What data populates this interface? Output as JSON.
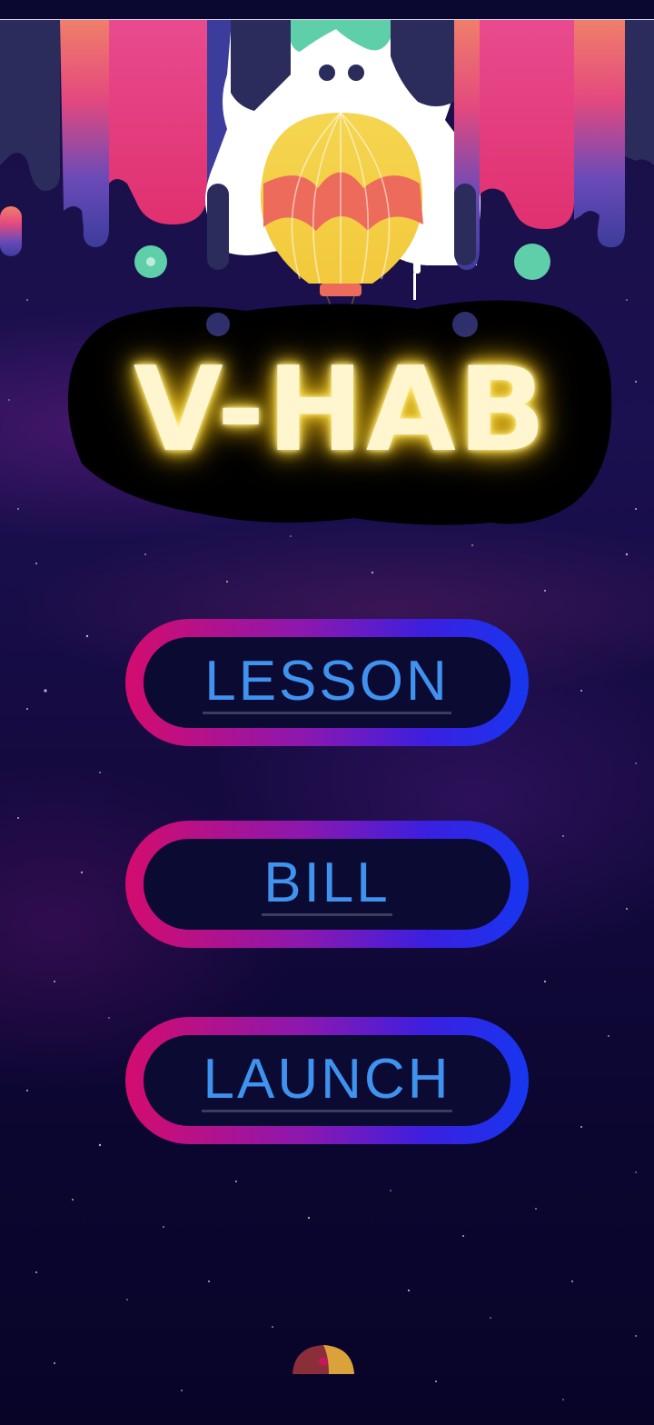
{
  "app": {
    "title": "V-HAB",
    "accent_color": "#fff6cf",
    "glow_color": "#f2c616"
  },
  "menu": {
    "buttons": [
      {
        "label": "LESSON",
        "icon": "none"
      },
      {
        "label": "BILL",
        "icon": "none"
      },
      {
        "label": "LAUNCH",
        "icon": "none"
      }
    ],
    "label_color": "#3f92ee",
    "border_gradient": [
      "#d40c6e",
      "#8a18b0",
      "#1637f0"
    ]
  },
  "decor": {
    "header_art": "hot-air-balloon-icon",
    "bottom_indicator": "half-circle-icon"
  }
}
